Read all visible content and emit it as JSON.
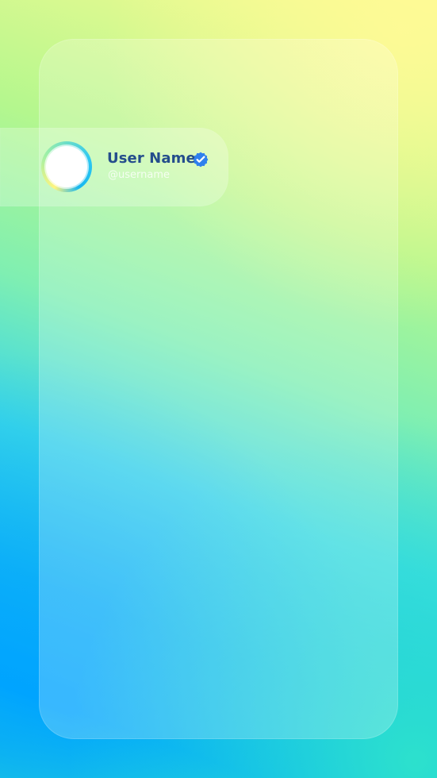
{
  "profile": {
    "display_name": "User Name",
    "handle": "@username",
    "avatar_icon": "blank-avatar",
    "verified_icon": "verified-badge-icon"
  },
  "colors": {
    "accent_blue": "#2f80ed",
    "name_text": "#244d8c",
    "handle_text": "#ffffffc7",
    "background_top": "#fdfb92",
    "background_bottom": "#00a9ff"
  }
}
